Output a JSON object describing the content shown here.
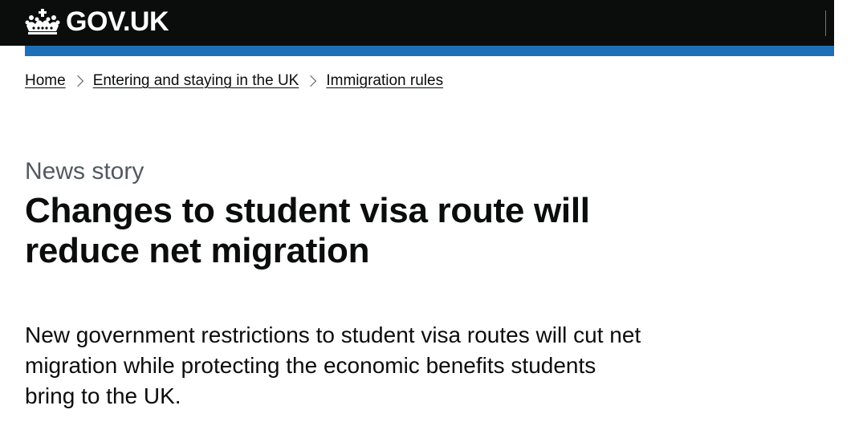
{
  "header": {
    "logo_text": "GOV.UK",
    "logo_icon": "crown-icon",
    "colors": {
      "header_bg": "#0b0c0c",
      "accent_bar": "#1d70b8"
    }
  },
  "breadcrumb": {
    "items": [
      {
        "label": "Home"
      },
      {
        "label": "Entering and staying in the UK"
      },
      {
        "label": "Immigration rules"
      }
    ],
    "separator_icon": "chevron-right-icon"
  },
  "article": {
    "caption": "News story",
    "title": "Changes to student visa route will reduce net migration",
    "lead": "New government restrictions to student visa routes will cut net migration while protecting the economic benefits students bring to the UK."
  }
}
